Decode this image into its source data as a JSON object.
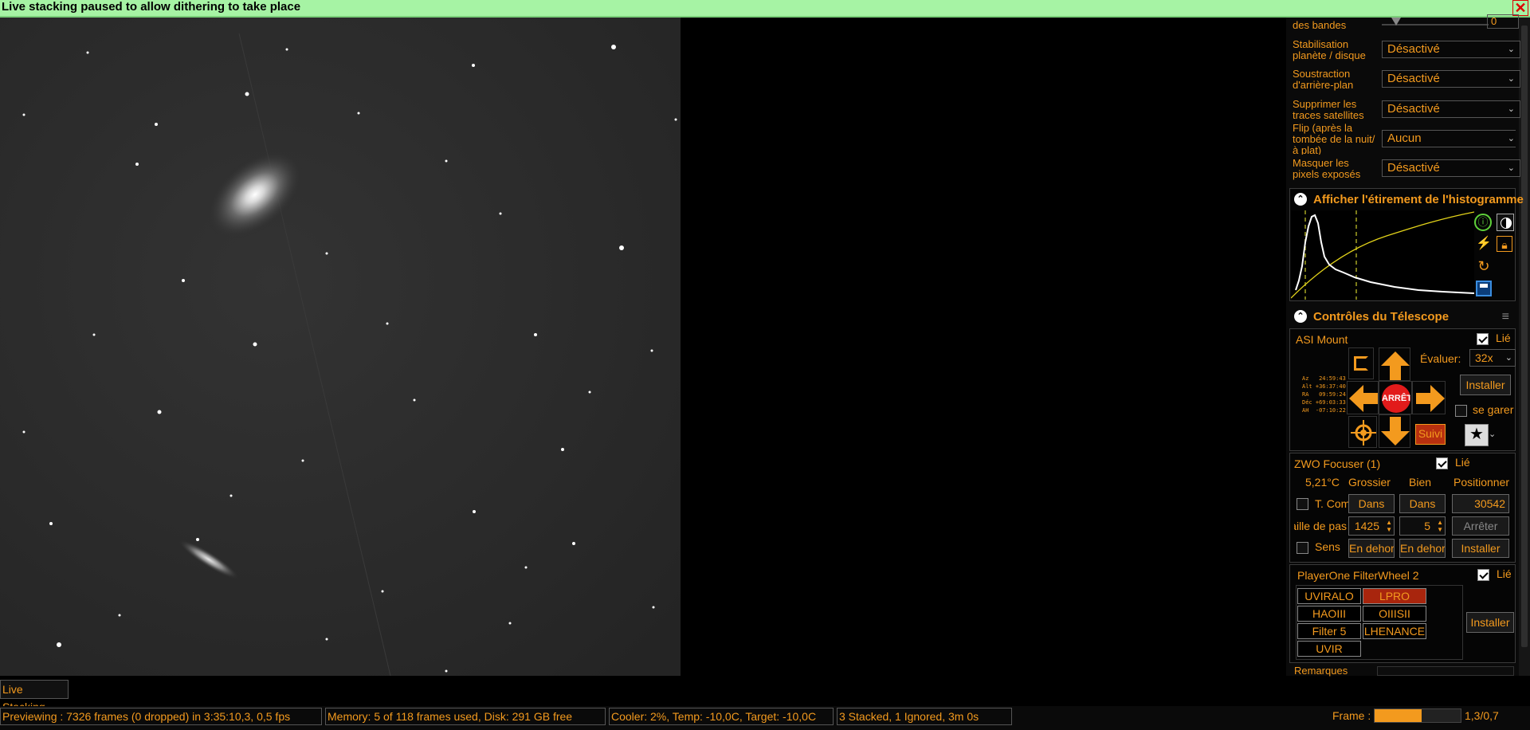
{
  "topbar": {
    "message": "Live stacking paused to allow dithering to take place",
    "close": "✕"
  },
  "stack_settings": [
    {
      "label": "des bandes",
      "value": "",
      "kind": "slider",
      "box": "0"
    },
    {
      "label": "Stabilisation planète / disque",
      "value": "Désactivé"
    },
    {
      "label": "Soustraction d'arrière-plan",
      "value": "Désactivé"
    },
    {
      "label": "Supprimer les traces satellites",
      "value": "Désactivé"
    },
    {
      "label": "Flip (après la tombée de la nuit/à plat)",
      "value": "Aucun"
    },
    {
      "label": "Masquer les pixels exposés",
      "value": "Désactivé"
    }
  ],
  "histogram": {
    "title": "Afficher l'étirement de l'histogramme"
  },
  "telescope": {
    "title": "Contrôles du Télescope",
    "mount_name": "ASI Mount",
    "linked_label": "Lié",
    "rate_label": "Évaluer:",
    "rate_value": "32x",
    "stop_label": "ARRÊTER",
    "install_label": "Installer",
    "park_label": "se garer",
    "track_label": "Suivi",
    "coords": "Az   24:59:43\nAlt +36:37:40\nRA   09:59:24\nDéc +69:03:33\nAH  -07:10:22"
  },
  "focuser": {
    "name": "ZWO Focuser (1)",
    "linked_label": "Lié",
    "temp": "5,21°C",
    "coarse_label": "Grossier",
    "fine_label": "Bien",
    "position_label": "Positionner",
    "tcomp_label": "T. Comp",
    "in_label": "Dans",
    "position_value": "30542",
    "step_label": "Taille de pas",
    "coarse_step": "1425",
    "fine_step": "5",
    "stop_label": "Arrêter",
    "sens_label": "Sens",
    "out_label": "En dehors",
    "install_label": "Installer"
  },
  "filterwheel": {
    "name": "PlayerOne FilterWheel 2",
    "linked_label": "Lié",
    "filters": [
      "UVIRALO",
      "LPRO",
      "HAOIII",
      "OIIISII",
      "Filter 5",
      "LHENANCE",
      "UVIR"
    ],
    "active": "LPRO",
    "install_label": "Installer"
  },
  "remarks_label": "Remarques",
  "live_stacking_tab": "Live Stacking",
  "status": {
    "preview": "Previewing : 7326 frames (0 dropped) in 3:35:10,3, 0,5 fps",
    "memory": "Memory: 5 of 118 frames used, Disk: 291 GB free",
    "cooler": "Cooler: 2%, Temp: -10,0C, Target: -10,0C",
    "stacked": "3 Stacked, 1 Ignored, 3m 0s",
    "frame_label": "Frame :",
    "frame_progress": 0.55,
    "frame_value": "1,3/0,7"
  },
  "colors": {
    "accent": "#f39a1e",
    "topbar_bg": "#a6f3a4",
    "active_filter": "#a8250d",
    "stop_red": "#e21b1b"
  }
}
